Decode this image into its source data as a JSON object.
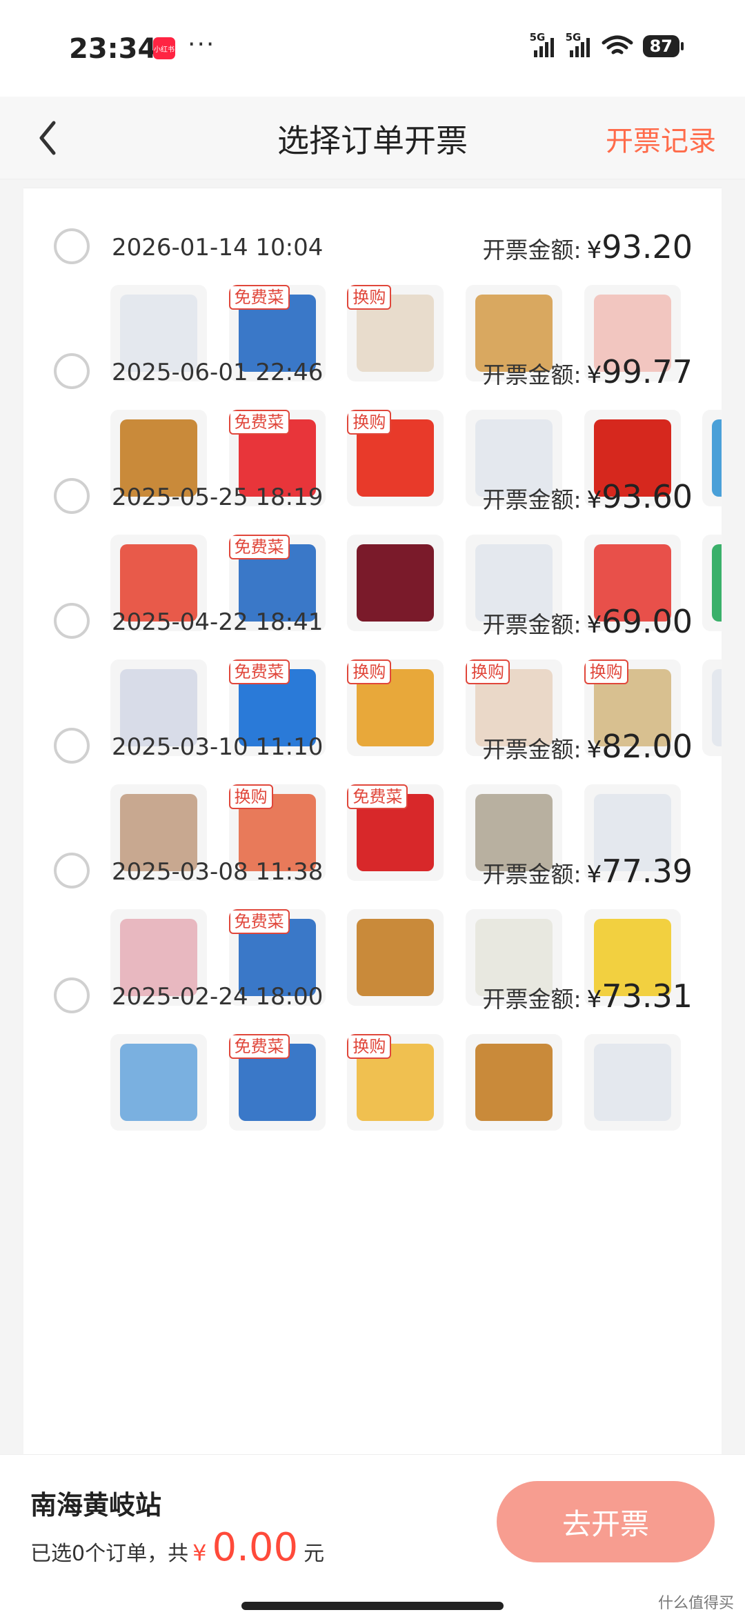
{
  "status_bar": {
    "time": "23:34",
    "app_badge": "小红书",
    "dots": "···",
    "signal_1": "5G",
    "signal_2": "5G",
    "battery": "87"
  },
  "header": {
    "back_icon": "chevron-left-icon",
    "title": "选择订单开票",
    "record_link": "开票记录"
  },
  "amount_label": "开票金额",
  "currency": "¥",
  "orders": [
    {
      "date": "2026-01-14 10:04",
      "amount": "93.20",
      "items": [
        {
          "tag": "",
          "color": "#e4e8ee"
        },
        {
          "tag": "免费菜",
          "color": "#3a78c8"
        },
        {
          "tag": "换购",
          "color": "#e8dccc"
        },
        {
          "tag": "",
          "color": "#d9a860"
        },
        {
          "tag": "",
          "color": "#f2c6c0"
        }
      ]
    },
    {
      "date": "2025-06-01 22:46",
      "amount": "99.77",
      "items": [
        {
          "tag": "",
          "color": "#c98a3a"
        },
        {
          "tag": "免费菜",
          "color": "#e8353a"
        },
        {
          "tag": "换购",
          "color": "#e83a2a"
        },
        {
          "tag": "",
          "color": "#e4e8ee"
        },
        {
          "tag": "",
          "color": "#d6281e"
        },
        {
          "tag": "",
          "color": "#4aa0d8"
        }
      ]
    },
    {
      "date": "2025-05-25 18:19",
      "amount": "93.60",
      "items": [
        {
          "tag": "",
          "color": "#e85a4a"
        },
        {
          "tag": "免费菜",
          "color": "#3a78c8"
        },
        {
          "tag": "",
          "color": "#7a1a2a"
        },
        {
          "tag": "",
          "color": "#e4e8ee"
        },
        {
          "tag": "",
          "color": "#e8504a"
        },
        {
          "tag": "",
          "color": "#3ab06a"
        }
      ]
    },
    {
      "date": "2025-04-22 18:41",
      "amount": "69.00",
      "items": [
        {
          "tag": "",
          "color": "#d8dce8"
        },
        {
          "tag": "免费菜",
          "color": "#2a7ad8"
        },
        {
          "tag": "换购",
          "color": "#e8a83a"
        },
        {
          "tag": "换购",
          "color": "#ead8c8"
        },
        {
          "tag": "换购",
          "color": "#d8c090"
        },
        {
          "tag": "",
          "color": "#e4e8ee"
        }
      ]
    },
    {
      "date": "2025-03-10 11:10",
      "amount": "82.00",
      "items": [
        {
          "tag": "",
          "color": "#c8a890"
        },
        {
          "tag": "换购",
          "color": "#e87a5a"
        },
        {
          "tag": "免费菜",
          "color": "#d8282a"
        },
        {
          "tag": "",
          "color": "#b8b0a0"
        },
        {
          "tag": "",
          "color": "#e4e8ee"
        }
      ]
    },
    {
      "date": "2025-03-08 11:38",
      "amount": "77.39",
      "items": [
        {
          "tag": "",
          "color": "#e8b8c0"
        },
        {
          "tag": "免费菜",
          "color": "#3a78c8"
        },
        {
          "tag": "",
          "color": "#c98a3a"
        },
        {
          "tag": "",
          "color": "#e8e8e0"
        },
        {
          "tag": "",
          "color": "#f2d040"
        }
      ]
    },
    {
      "date": "2025-02-24 18:00",
      "amount": "73.31",
      "items": [
        {
          "tag": "",
          "color": "#7ab0e0"
        },
        {
          "tag": "免费菜",
          "color": "#3a78c8"
        },
        {
          "tag": "换购",
          "color": "#f0c050"
        },
        {
          "tag": "",
          "color": "#c98a3a"
        },
        {
          "tag": "",
          "color": "#e4e8ee"
        }
      ]
    }
  ],
  "bottom": {
    "station": "南海黄岐站",
    "selected_text": "已选0个订单，共",
    "currency": "¥",
    "total": "0.00",
    "unit": "元",
    "button": "去开票"
  },
  "watermark": "什么值得买",
  "colors": {
    "accent": "#ff6b4a",
    "price": "#ff4a3a",
    "tag": "#e0463a",
    "button": "#f79d90"
  }
}
